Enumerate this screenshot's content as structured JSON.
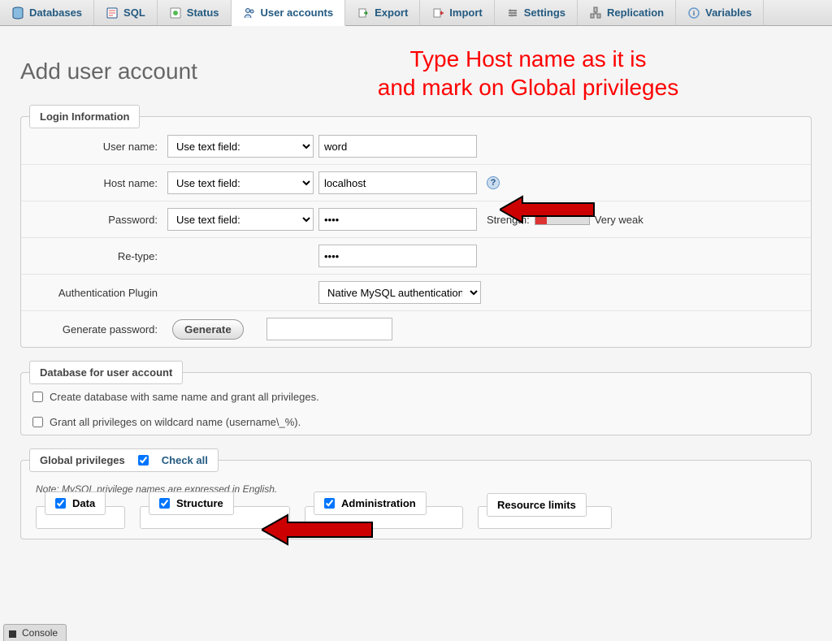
{
  "tabs": {
    "databases": "Databases",
    "sql": "SQL",
    "status": "Status",
    "users": "User accounts",
    "export": "Export",
    "import": "Import",
    "settings": "Settings",
    "replication": "Replication",
    "variables": "Variables"
  },
  "page_title": "Add user account",
  "annotation": {
    "line1": "Type Host name as it is",
    "line2": "and mark on Global privileges"
  },
  "login": {
    "legend": "Login Information",
    "username_label": "User name:",
    "username_mode": "Use text field:",
    "username_value": "word",
    "host_label": "Host name:",
    "host_mode": "Use text field:",
    "host_value": "localhost",
    "password_label": "Password:",
    "password_mode": "Use text field:",
    "password_value": "••••",
    "strength_label": "Strength:",
    "strength_rating": "Very weak",
    "retype_label": "Re-type:",
    "retype_value": "••••",
    "auth_label": "Authentication Plugin",
    "auth_value": "Native MySQL authentication",
    "genpass_label": "Generate password:",
    "gen_btn": "Generate"
  },
  "db_section": {
    "legend": "Database for user account",
    "opt1": "Create database with same name and grant all privileges.",
    "opt2": "Grant all privileges on wildcard name (username\\_%)."
  },
  "global": {
    "legend": "Global privileges",
    "checkall": "Check all",
    "note": "Note: MySQL privilege names are expressed in English.",
    "groups": {
      "data": "Data",
      "structure": "Structure",
      "administration": "Administration",
      "resource": "Resource limits"
    }
  },
  "console": "Console"
}
